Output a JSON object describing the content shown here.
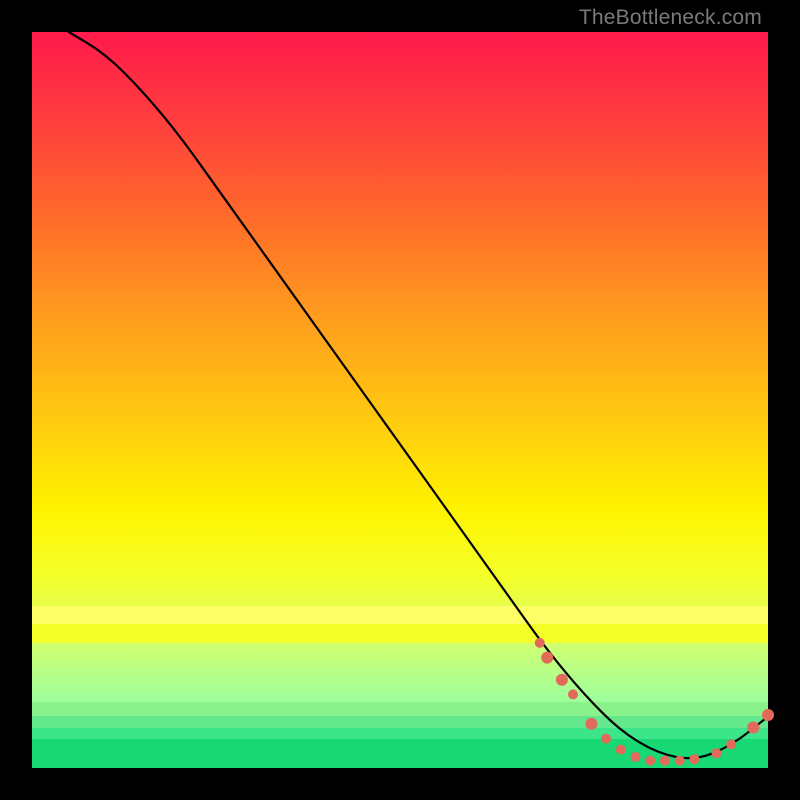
{
  "watermark": "TheBottleneck.com",
  "chart_data": {
    "type": "line",
    "title": "",
    "xlabel": "",
    "ylabel": "",
    "xlim": [
      0,
      100
    ],
    "ylim": [
      0,
      100
    ],
    "grid": false,
    "legend": false,
    "series": [
      {
        "name": "bottleneck-curve",
        "color": "#000000",
        "x": [
          5,
          10,
          15,
          20,
          25,
          30,
          35,
          40,
          45,
          50,
          55,
          60,
          65,
          70,
          75,
          80,
          85,
          90,
          95,
          100
        ],
        "y": [
          100,
          97,
          92,
          86,
          79,
          72,
          65,
          58,
          51,
          44,
          37,
          30,
          23,
          16,
          10,
          5,
          2,
          1,
          3,
          7
        ]
      }
    ],
    "markers": [
      {
        "x": 69,
        "y": 17,
        "r": 5,
        "color": "#e26a5a"
      },
      {
        "x": 70,
        "y": 15,
        "r": 6,
        "color": "#e26a5a"
      },
      {
        "x": 72,
        "y": 12,
        "r": 6,
        "color": "#e26a5a"
      },
      {
        "x": 73.5,
        "y": 10,
        "r": 5,
        "color": "#e26a5a"
      },
      {
        "x": 76,
        "y": 6,
        "r": 6,
        "color": "#e26a5a"
      },
      {
        "x": 78,
        "y": 4,
        "r": 5,
        "color": "#e26a5a"
      },
      {
        "x": 80,
        "y": 2.5,
        "r": 5,
        "color": "#e26a5a"
      },
      {
        "x": 82,
        "y": 1.5,
        "r": 5,
        "color": "#e26a5a"
      },
      {
        "x": 84,
        "y": 1,
        "r": 5,
        "color": "#e26a5a"
      },
      {
        "x": 86,
        "y": 1,
        "r": 5,
        "color": "#e26a5a"
      },
      {
        "x": 88,
        "y": 1,
        "r": 5,
        "color": "#e26a5a"
      },
      {
        "x": 90,
        "y": 1.2,
        "r": 5,
        "color": "#e26a5a"
      },
      {
        "x": 93,
        "y": 2,
        "r": 5,
        "color": "#e26a5a"
      },
      {
        "x": 95,
        "y": 3.2,
        "r": 5,
        "color": "#e26a5a"
      },
      {
        "x": 98,
        "y": 5.5,
        "r": 6,
        "color": "#e26a5a"
      },
      {
        "x": 100,
        "y": 7.2,
        "r": 6,
        "color": "#e26a5a"
      }
    ],
    "bands": [
      {
        "y0": 78,
        "y1": 80.5,
        "color": "#feff66"
      },
      {
        "y0": 80.5,
        "y1": 83,
        "color": "#f4ff2a"
      },
      {
        "y0": 91,
        "y1": 93,
        "color": "#8bf28b"
      },
      {
        "y0": 93,
        "y1": 94.5,
        "color": "#63e88e"
      },
      {
        "y0": 94.5,
        "y1": 96,
        "color": "#3de58a"
      },
      {
        "y0": 96,
        "y1": 100,
        "color": "#18d873"
      }
    ]
  }
}
